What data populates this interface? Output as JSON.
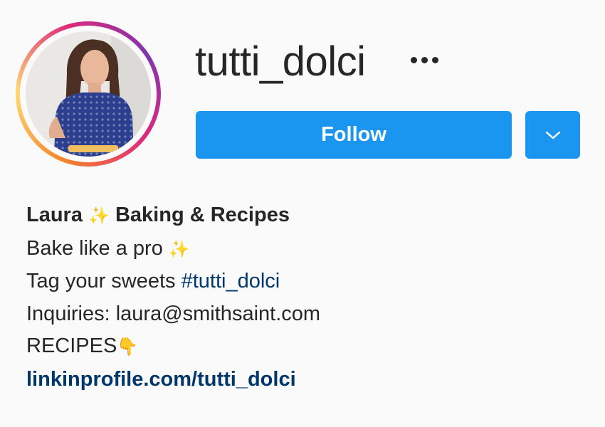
{
  "profile": {
    "username": "tutti_dolci",
    "follow_label": "Follow",
    "more_icon": "more-options-icon",
    "dropdown_icon": "chevron-down-icon"
  },
  "bio": {
    "name_part1": "Laura ",
    "name_emoji": "✨",
    "name_part2": " Baking & Recipes",
    "line2_text": "Bake like a pro ",
    "line2_emoji": "✨",
    "line3_text": "Tag your sweets ",
    "line3_hashtag": "#tutti_dolci",
    "line4_text": "Inquiries: laura@smithsaint.com",
    "line5_text": "RECIPES",
    "line5_emoji": "👇",
    "link": "linkinprofile.com/tutti_dolci"
  },
  "colors": {
    "follow_button": "#1a95f0",
    "link": "#00376b",
    "text": "#262626",
    "background": "#fafafa"
  }
}
